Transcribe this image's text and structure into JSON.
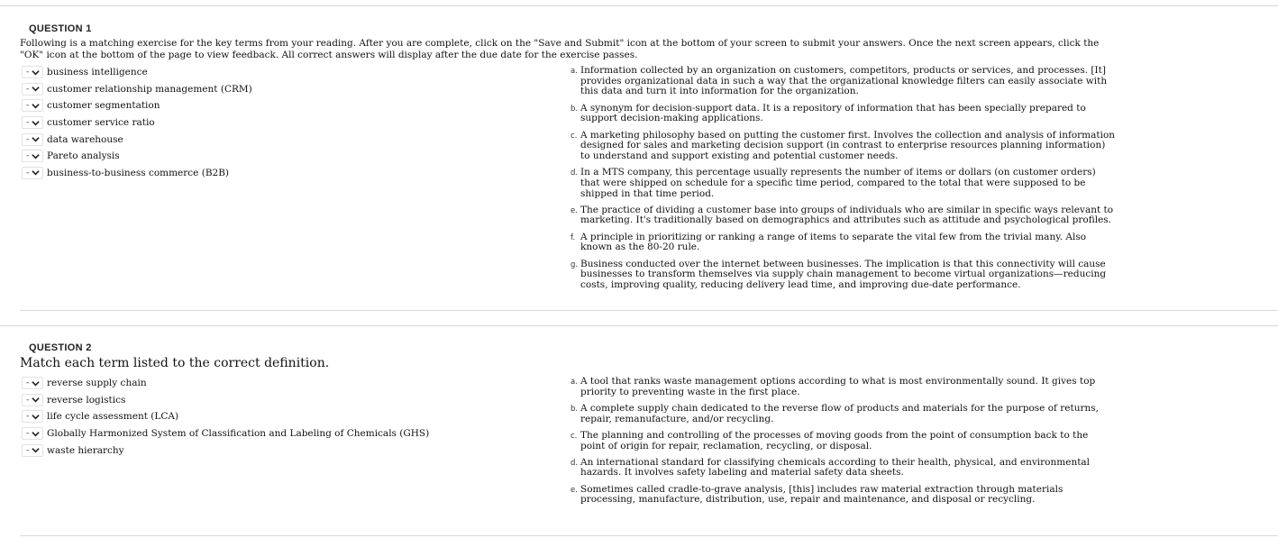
{
  "q1": {
    "title": "QUESTION 1",
    "instructions": "Following is a matching exercise for the key terms from your reading.  After you are complete, click on the \"Save and Submit\" icon at the bottom of your screen to submit your answers.  Once the next screen appears, click the \"OK\" icon at the bottom of the page to view feedback. All correct answers will display after the due date for the exercise passes.",
    "select_value": "-",
    "terms": [
      "business intelligence",
      "customer relationship management (CRM)",
      "customer segmentation",
      "customer service ratio",
      "data warehouse",
      "Pareto analysis",
      "business-to-business commerce (B2B)"
    ],
    "definitions": [
      {
        "letter": "a.",
        "text": "Information collected by an organization on customers, competitors, products or services, and processes. [It] provides organizational data in such a way that the organizational knowledge filters can easily associate with this data and turn it into information for the organization."
      },
      {
        "letter": "b.",
        "text": "A synonym for decision-support data. It is a repository of information that has been specially prepared to support decision-making applications."
      },
      {
        "letter": "c.",
        "text": "A marketing philosophy based on putting the customer first. Involves the collection and analysis of information designed for sales and marketing decision support (in contrast to enterprise resources planning information) to understand and support existing and potential customer needs."
      },
      {
        "letter": "d.",
        "text": "In a MTS company, this percentage usually represents the number of items or dollars (on customer orders) that were shipped on schedule for a specific time period, compared to the total that were supposed to be shipped in that time period."
      },
      {
        "letter": "e.",
        "text": "The practice of dividing a customer base into groups of individuals who are similar in specific ways relevant to marketing. It's traditionally based on demographics and attributes such as attitude and psychological profiles."
      },
      {
        "letter": "f.",
        "text": "A principle in prioritizing or ranking a range of items to separate the vital few from the trivial many. Also known as the 80-20 rule."
      },
      {
        "letter": "g.",
        "text": "Business conducted over the internet between businesses. The implication is that this connectivity will cause businesses to transform themselves via supply chain management to become virtual organizations—reducing costs, improving quality, reducing delivery lead time, and improving due-date performance."
      }
    ]
  },
  "q2": {
    "title": "QUESTION 2",
    "instructions": "Match each term listed to the correct definition.",
    "select_value": "-",
    "terms": [
      "reverse supply chain",
      "reverse logistics",
      "life cycle assessment (LCA)",
      "Globally Harmonized System of Classification and Labeling of Chemicals (GHS)",
      "waste hierarchy"
    ],
    "definitions": [
      {
        "letter": "a.",
        "text": "A tool that ranks waste management options according to what is most environmentally sound. It gives top priority to preventing waste in the first place."
      },
      {
        "letter": "b.",
        "text": "A complete supply chain dedicated to the reverse flow of products and materials for the purpose of returns, repair, remanufacture, and/or recycling."
      },
      {
        "letter": "c.",
        "text": "The planning and controlling of the processes of moving goods from the point of consumption back to the point of origin for repair, reclamation, recycling, or disposal."
      },
      {
        "letter": "d.",
        "text": "An international standard for classifying chemicals according to their health, physical, and environmental hazards. It involves safety labeling and material safety data sheets."
      },
      {
        "letter": "e.",
        "text": "Sometimes called cradle-to-grave analysis, [this] includes raw material extraction through materials processing, manufacture, distribution, use, repair and maintenance, and disposal or recycling."
      }
    ]
  }
}
